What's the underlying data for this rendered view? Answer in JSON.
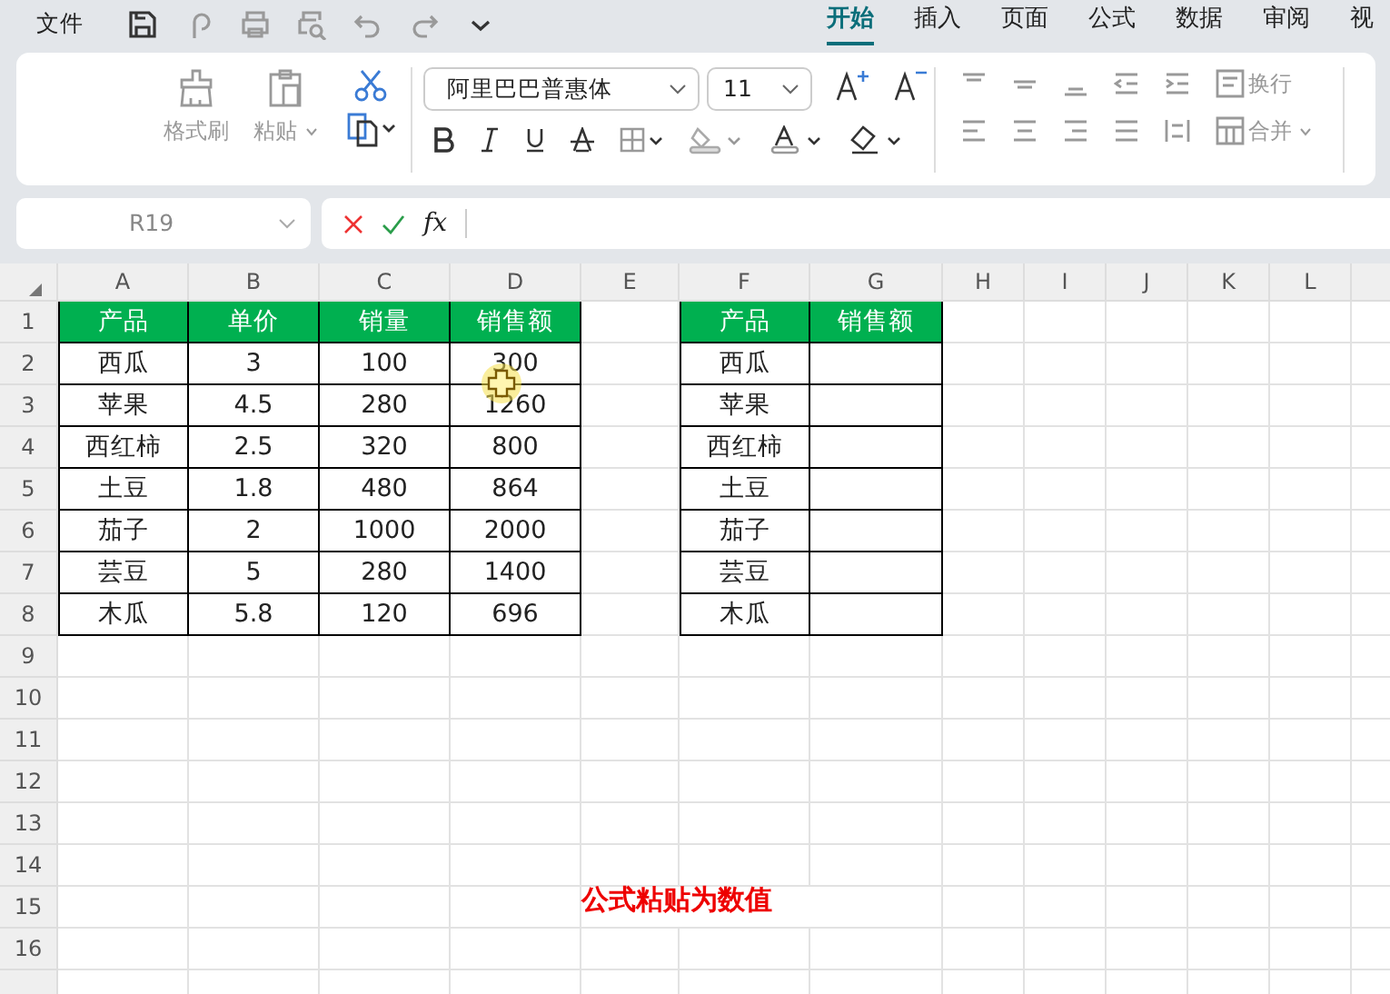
{
  "menu": {
    "label": "文件"
  },
  "tabs": [
    {
      "label": "开始",
      "selected": true
    },
    {
      "label": "插入",
      "selected": false
    },
    {
      "label": "页面",
      "selected": false
    },
    {
      "label": "公式",
      "selected": false
    },
    {
      "label": "数据",
      "selected": false
    },
    {
      "label": "审阅",
      "selected": false
    },
    {
      "label": "视",
      "selected": false
    }
  ],
  "ribbon": {
    "format_painter": "格式刷",
    "paste": "粘贴",
    "font_name": "阿里巴巴普惠体",
    "font_size": "11",
    "wrap": "换行",
    "merge": "合并"
  },
  "name_box": "R19",
  "formula_bar": {
    "fx": "fx"
  },
  "columns": [
    "A",
    "B",
    "C",
    "D",
    "E",
    "F",
    "G",
    "H",
    "I",
    "J",
    "K",
    "L"
  ],
  "rows": [
    "1",
    "2",
    "3",
    "4",
    "5",
    "6",
    "7",
    "8",
    "9",
    "10",
    "11",
    "12",
    "13",
    "14",
    "15",
    "16"
  ],
  "table_1": {
    "headers": [
      "产品",
      "单价",
      "销量",
      "销售额"
    ],
    "rows": [
      [
        "西瓜",
        "3",
        "100",
        "300"
      ],
      [
        "苹果",
        "4.5",
        "280",
        "1260"
      ],
      [
        "西红柿",
        "2.5",
        "320",
        "800"
      ],
      [
        "土豆",
        "1.8",
        "480",
        "864"
      ],
      [
        "茄子",
        "2",
        "1000",
        "2000"
      ],
      [
        "芸豆",
        "5",
        "280",
        "1400"
      ],
      [
        "木瓜",
        "5.8",
        "120",
        "696"
      ]
    ]
  },
  "table_2": {
    "headers": [
      "产品",
      "销售额"
    ],
    "rows": [
      [
        "西瓜",
        ""
      ],
      [
        "苹果",
        ""
      ],
      [
        "西红柿",
        ""
      ],
      [
        "土豆",
        ""
      ],
      [
        "茄子",
        ""
      ],
      [
        "芸豆",
        ""
      ],
      [
        "木瓜",
        ""
      ]
    ]
  },
  "caption": "公式粘贴为数值"
}
